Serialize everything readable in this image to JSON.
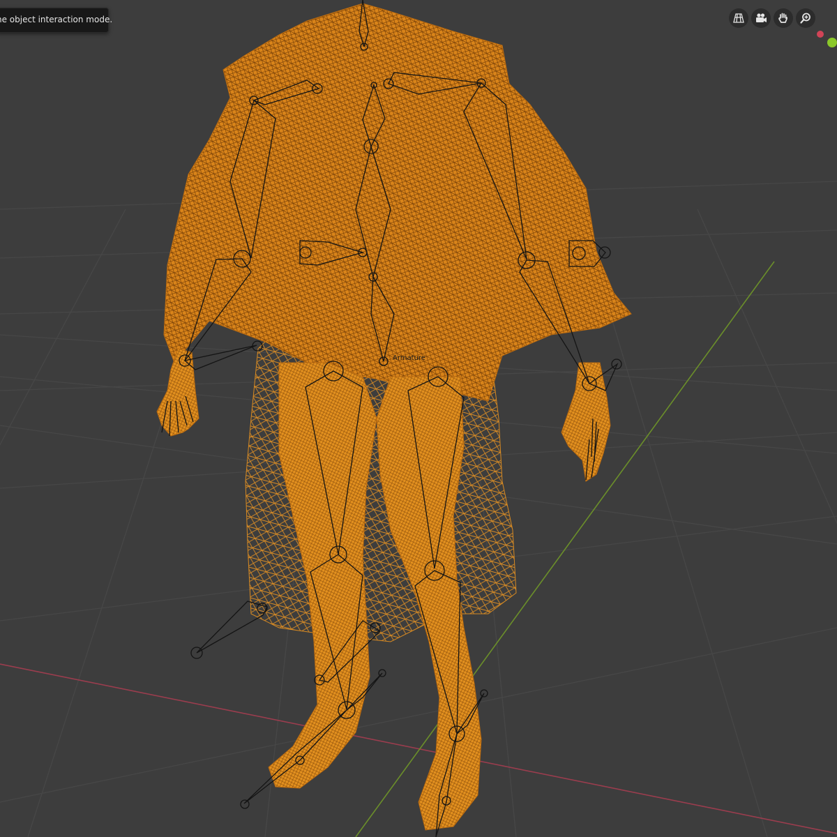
{
  "tooltip": {
    "text": "he object interaction mode."
  },
  "viewport": {
    "object_label": "Armature",
    "background_color": "#3d3d3d",
    "grid_color": "#474747",
    "x_axis_color": "#9b3d4e",
    "y_axis_color": "#6b8f2a",
    "mesh_color": "#e8901f",
    "bone_color": "#141414"
  },
  "navigation": {
    "buttons": [
      {
        "name": "toggle-perspective",
        "icon": "grid-perspective-icon"
      },
      {
        "name": "camera-view",
        "icon": "camera-icon"
      },
      {
        "name": "pan-view",
        "icon": "hand-icon"
      },
      {
        "name": "zoom-view",
        "icon": "magnifier-icon"
      }
    ],
    "gizmo_colors": {
      "x": "#d04457",
      "y": "#8bc82a"
    }
  }
}
